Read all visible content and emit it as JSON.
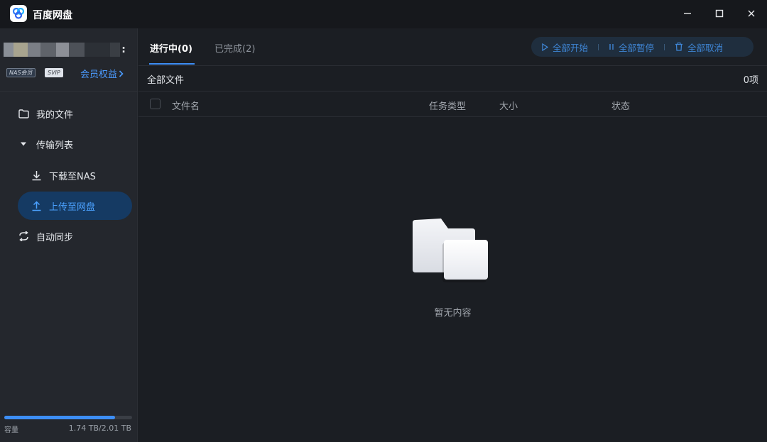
{
  "app": {
    "title": "百度网盘"
  },
  "window_controls": {
    "minimize": "—",
    "maximize": "□",
    "close": "✕"
  },
  "sidebar": {
    "more_icon": ":",
    "badges": {
      "nas": "NAS会员",
      "svip": "SVIP"
    },
    "member_link": "会员权益",
    "items": [
      {
        "label": "我的文件",
        "icon": "folder-icon"
      },
      {
        "label": "传输列表",
        "icon": "caret-down-icon"
      },
      {
        "label": "下载至NAS",
        "icon": "download-icon"
      },
      {
        "label": "上传至网盘",
        "icon": "upload-icon",
        "active": true
      },
      {
        "label": "自动同步",
        "icon": "sync-icon"
      }
    ],
    "capacity": {
      "label": "容量",
      "value": "1.74 TB/2.01 TB",
      "used_fraction": 0.866
    }
  },
  "main": {
    "tabs": [
      {
        "label": "进行中(0)",
        "active": true
      },
      {
        "label": "已完成(2)",
        "active": false
      }
    ],
    "toolbar": {
      "start_all": "全部开始",
      "pause_all": "全部暂停",
      "cancel_all": "全部取消"
    },
    "breadcrumb": "全部文件",
    "count": "0项",
    "columns": {
      "name": "文件名",
      "type": "任务类型",
      "size": "大小",
      "status": "状态"
    },
    "empty_text": "暂无内容"
  },
  "colors": {
    "accent": "#3d8ef5",
    "active_bg": "#153a63",
    "background": "#1b1e23",
    "sidebar": "#24272d"
  }
}
